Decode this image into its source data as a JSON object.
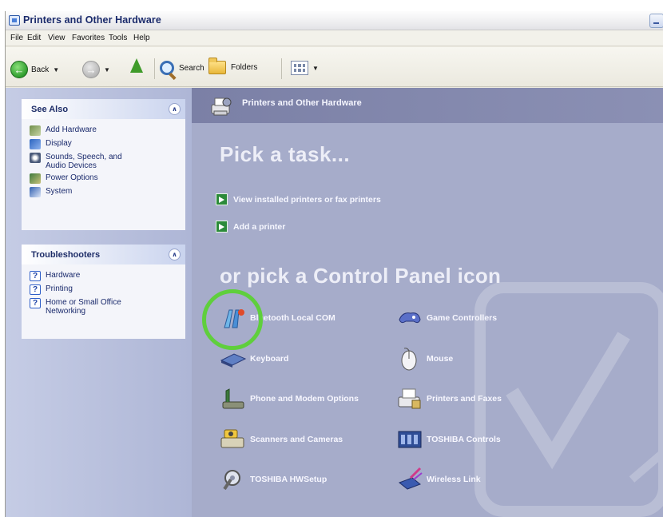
{
  "window": {
    "title": "Printers and Other Hardware"
  },
  "menu": [
    "File",
    "Edit",
    "View",
    "Favorites",
    "Tools",
    "Help"
  ],
  "toolbar": {
    "back_label": "Back",
    "search_label": "Search",
    "folders_label": "Folders"
  },
  "sidebar": {
    "see_also": {
      "title": "See Also",
      "items": [
        {
          "label": "Add Hardware",
          "icon": "add-hardware-icon"
        },
        {
          "label": "Display",
          "icon": "display-icon"
        },
        {
          "label": "Sounds, Speech, and\nAudio Devices",
          "icon": "sound-icon"
        },
        {
          "label": "Power Options",
          "icon": "power-icon"
        },
        {
          "label": "System",
          "icon": "system-icon"
        }
      ]
    },
    "troubleshooters": {
      "title": "Troubleshooters",
      "items": [
        {
          "label": "Hardware",
          "icon": "help-icon"
        },
        {
          "label": "Printing",
          "icon": "help-icon"
        },
        {
          "label": "Home or Small Office\nNetworking",
          "icon": "help-icon"
        }
      ]
    }
  },
  "main": {
    "header_title": "Printers and Other Hardware",
    "pick_task": "Pick a task...",
    "tasks": [
      "View installed printers or fax printers",
      "Add a printer"
    ],
    "pick_icon": "or pick a Control Panel icon",
    "icons": [
      {
        "label": "Bluetooth Local COM",
        "icon": "bluetooth-com-icon"
      },
      {
        "label": "Game Controllers",
        "icon": "game-controller-icon"
      },
      {
        "label": "Keyboard",
        "icon": "keyboard-icon"
      },
      {
        "label": "Mouse",
        "icon": "mouse-icon"
      },
      {
        "label": "Phone and Modem Options",
        "icon": "phone-modem-icon"
      },
      {
        "label": "Printers and Faxes",
        "icon": "printer-fax-icon"
      },
      {
        "label": "Scanners and Cameras",
        "icon": "scanner-camera-icon"
      },
      {
        "label": "TOSHIBA Controls",
        "icon": "toshiba-controls-icon"
      },
      {
        "label": "TOSHIBA HWSetup",
        "icon": "toshiba-hwsetup-icon"
      },
      {
        "label": "Wireless Link",
        "icon": "wireless-link-icon"
      }
    ]
  },
  "colors": {
    "highlight_ring": "#5fcf3c",
    "content_bg": "#a6acca",
    "header_bg": "#7b80a6"
  }
}
